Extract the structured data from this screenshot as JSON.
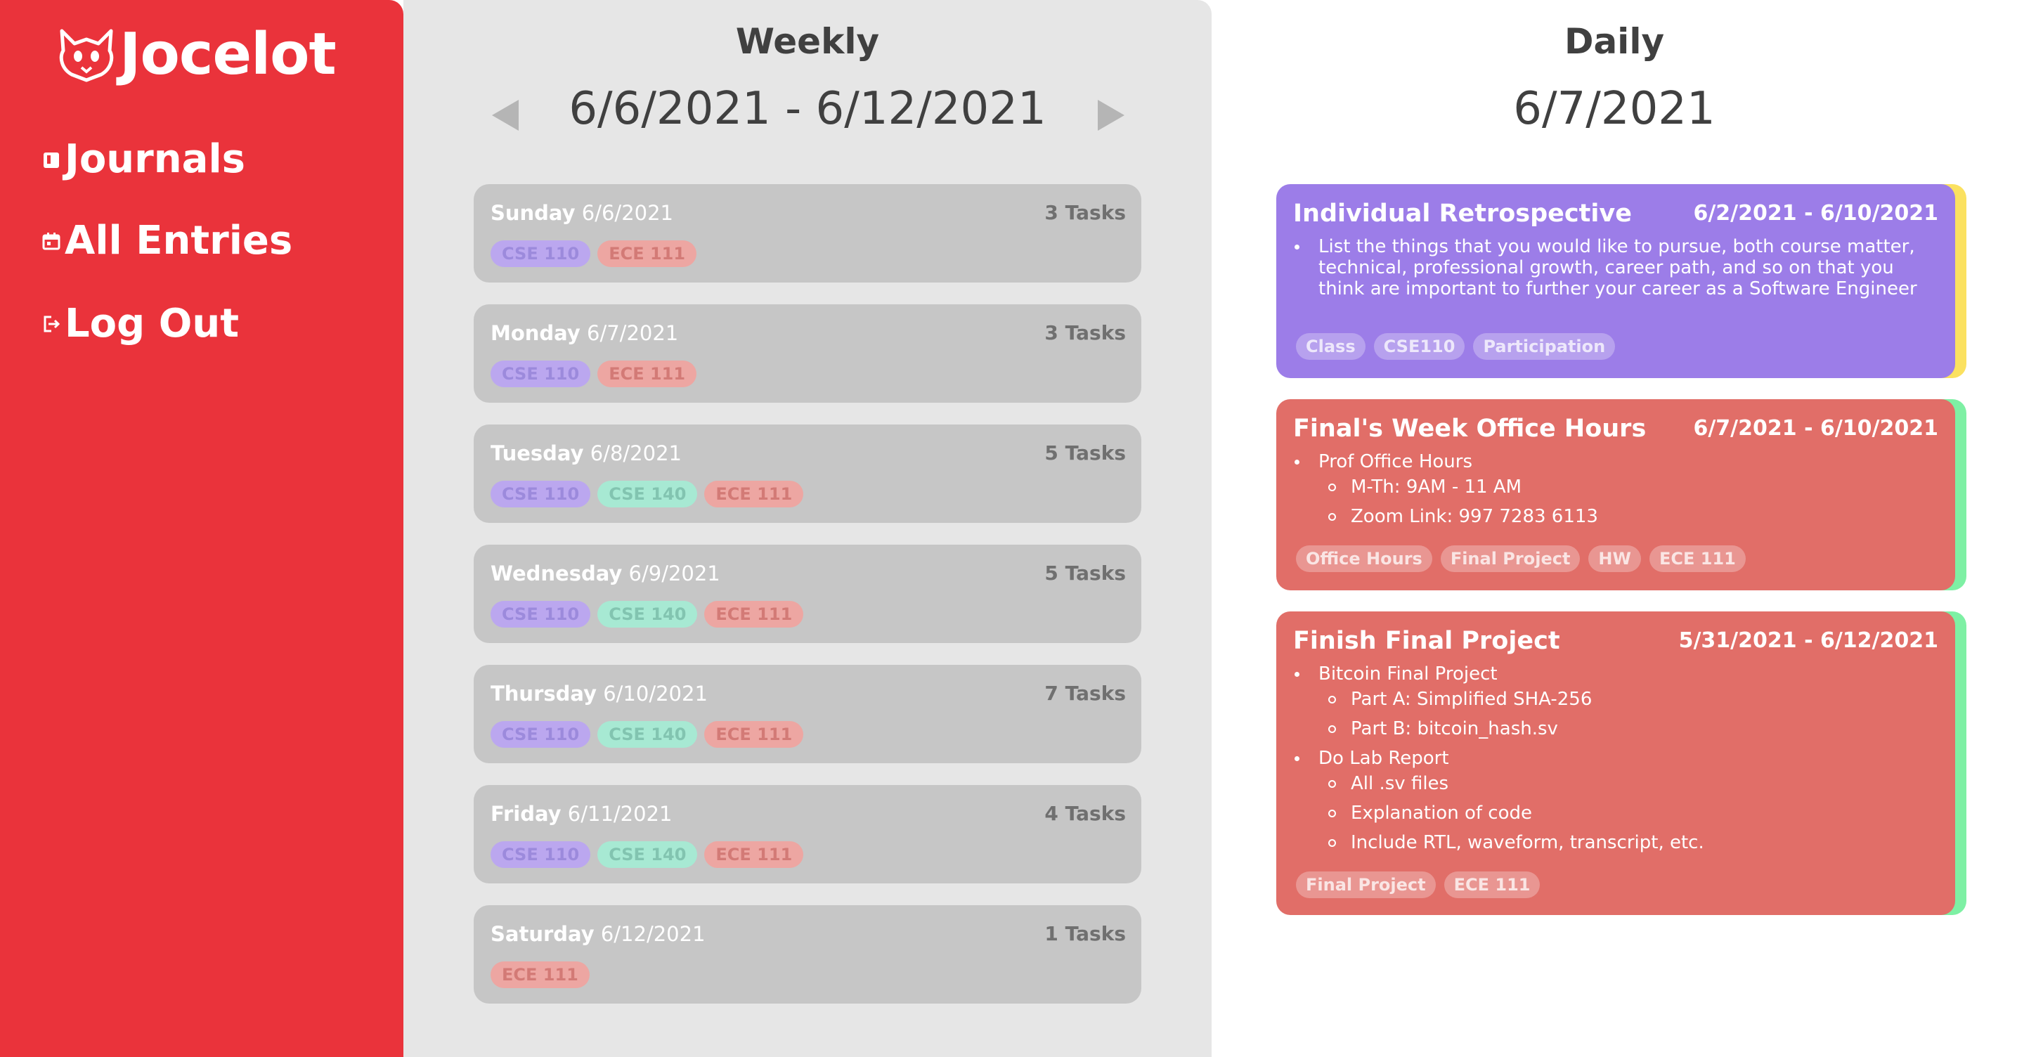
{
  "app": {
    "name": "Jocelot"
  },
  "sidebar": {
    "items": [
      {
        "label": "Journals",
        "icon": "journal-icon"
      },
      {
        "label": "All Entries",
        "icon": "calendar-icon"
      },
      {
        "label": "Log Out",
        "icon": "logout-icon"
      }
    ]
  },
  "weekly": {
    "title": "Weekly",
    "range": "6/6/2021 - 6/12/2021",
    "days": [
      {
        "day": "Sunday",
        "date": "6/6/2021",
        "count": "3 Tasks",
        "tags": [
          {
            "label": "CSE 110",
            "color": "purple"
          },
          {
            "label": "ECE 111",
            "color": "salmon"
          }
        ]
      },
      {
        "day": "Monday",
        "date": "6/7/2021",
        "count": "3 Tasks",
        "tags": [
          {
            "label": "CSE 110",
            "color": "purple"
          },
          {
            "label": "ECE 111",
            "color": "salmon"
          }
        ]
      },
      {
        "day": "Tuesday",
        "date": "6/8/2021",
        "count": "5 Tasks",
        "tags": [
          {
            "label": "CSE 110",
            "color": "purple"
          },
          {
            "label": "CSE 140",
            "color": "teal"
          },
          {
            "label": "ECE 111",
            "color": "salmon"
          }
        ]
      },
      {
        "day": "Wednesday",
        "date": "6/9/2021",
        "count": "5 Tasks",
        "tags": [
          {
            "label": "CSE 110",
            "color": "purple"
          },
          {
            "label": "CSE 140",
            "color": "teal"
          },
          {
            "label": "ECE 111",
            "color": "salmon"
          }
        ]
      },
      {
        "day": "Thursday",
        "date": "6/10/2021",
        "count": "7 Tasks",
        "tags": [
          {
            "label": "CSE 110",
            "color": "purple"
          },
          {
            "label": "CSE 140",
            "color": "teal"
          },
          {
            "label": "ECE 111",
            "color": "salmon"
          }
        ]
      },
      {
        "day": "Friday",
        "date": "6/11/2021",
        "count": "4 Tasks",
        "tags": [
          {
            "label": "CSE 110",
            "color": "purple"
          },
          {
            "label": "CSE 140",
            "color": "teal"
          },
          {
            "label": "ECE 111",
            "color": "salmon"
          }
        ]
      },
      {
        "day": "Saturday",
        "date": "6/12/2021",
        "count": "1 Tasks",
        "tags": [
          {
            "label": "ECE 111",
            "color": "salmon"
          }
        ]
      }
    ]
  },
  "daily": {
    "title": "Daily",
    "date": "6/7/2021",
    "entries": [
      {
        "title": "Individual Retrospective",
        "range": "6/2/2021 - 6/10/2021",
        "color": "#9c7de8",
        "stripe": "#fbe160",
        "bullets": [
          {
            "level": 1,
            "text": "List the things that you would like to pursue, both course matter, technical, professional growth, career path, and so on that you think are important to further your career as a Software Engineer"
          }
        ],
        "tags": [
          "Class",
          "CSE110",
          "Participation"
        ]
      },
      {
        "title": "Final's Week Office Hours",
        "range": "6/7/2021 - 6/10/2021",
        "color": "#e16e68",
        "stripe": "#7ef0a4",
        "bullets": [
          {
            "level": 1,
            "text": "Prof Office Hours"
          },
          {
            "level": 2,
            "text": "M-Th: 9AM - 11 AM"
          },
          {
            "level": 2,
            "text": "Zoom Link: 997 7283 6113"
          }
        ],
        "tags": [
          "Office Hours",
          "Final Project",
          "HW",
          "ECE 111"
        ]
      },
      {
        "title": "Finish Final Project",
        "range": "5/31/2021 - 6/12/2021",
        "color": "#e16e68",
        "stripe": "#7ef0a4",
        "bullets": [
          {
            "level": 1,
            "text": "Bitcoin Final Project"
          },
          {
            "level": 2,
            "text": "Part A: Simplified SHA-256"
          },
          {
            "level": 2,
            "text": "Part B: bitcoin_hash.sv"
          },
          {
            "level": 1,
            "text": "Do Lab Report"
          },
          {
            "level": 2,
            "text": "All .sv files"
          },
          {
            "level": 2,
            "text": "Explanation of code"
          },
          {
            "level": 2,
            "text": "Include RTL, waveform, transcript, etc."
          }
        ],
        "tags": [
          "Final Project",
          "ECE 111"
        ]
      }
    ]
  }
}
